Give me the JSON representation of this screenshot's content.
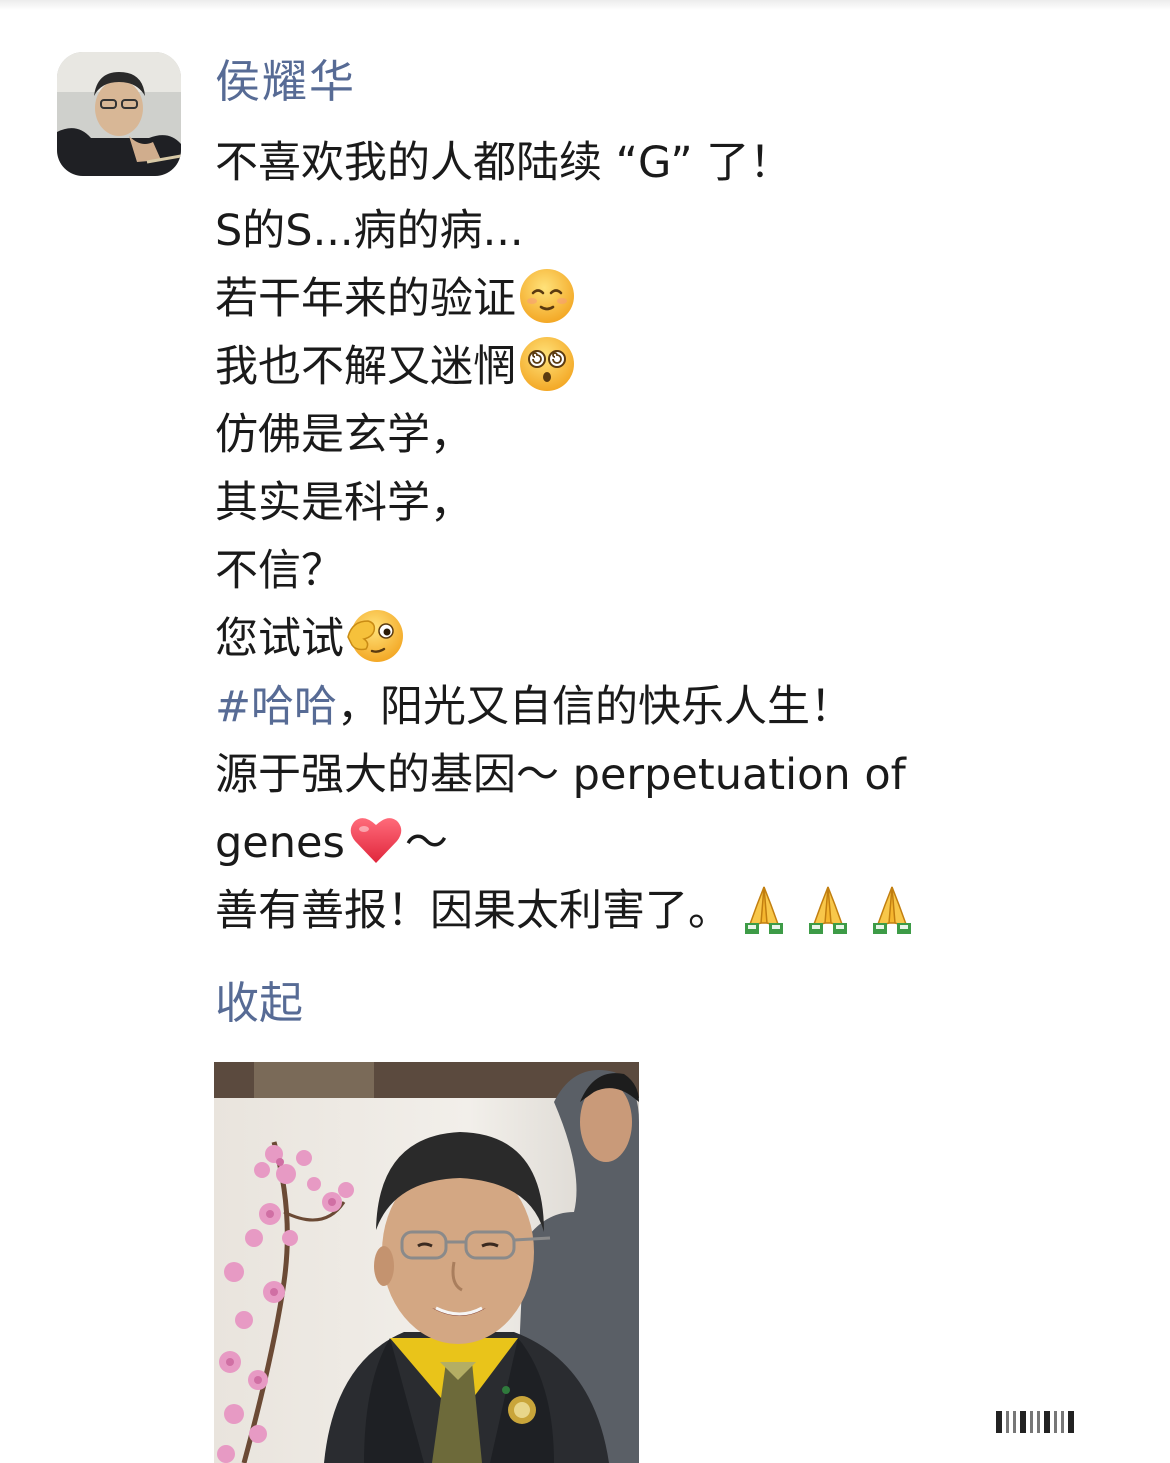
{
  "post": {
    "author": "侯耀华",
    "lines": [
      {
        "text": "不喜欢我的人都陆续 “G” 了！"
      },
      {
        "text": "S的S...病的病..."
      },
      {
        "text": "若干年来的验证",
        "emoji": "smiling-relieved-face-emoji"
      },
      {
        "text": "我也不解又迷惘",
        "emoji": "dizzy-face-emoji"
      },
      {
        "text": "仿佛是玄学，"
      },
      {
        "text": "其实是科学，"
      },
      {
        "text": "不信？"
      },
      {
        "text": "您试试",
        "emoji": "face-peeking-eye-emoji"
      },
      {
        "hashtag": "#哈哈",
        "text": "，阳光又自信的快乐人生！"
      },
      {
        "text": "源于强大的基因～ perpetuation of"
      },
      {
        "text": "genes",
        "emoji": "red-heart-emoji",
        "suffix": "～"
      },
      {
        "text": "善有善报！因果太利害了。",
        "emoji": "folded-hands-emoji",
        "emoji_count": 3
      }
    ],
    "collapse_label": "收起"
  },
  "colors": {
    "link": "#576b95",
    "text": "#1a1a1a",
    "background": "#ffffff"
  }
}
